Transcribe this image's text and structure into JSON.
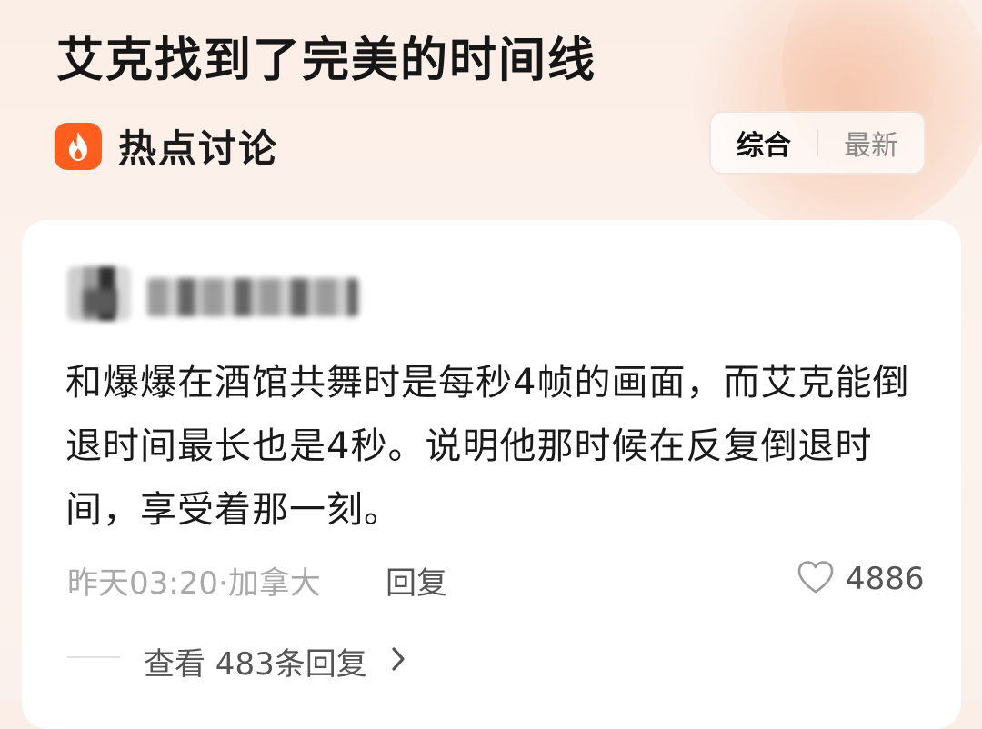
{
  "page": {
    "title": "艾克找到了完美的时间线"
  },
  "section": {
    "label": "热点讨论",
    "icon": "fire-icon",
    "accent_color": "#ff5e1f"
  },
  "sort": {
    "options": [
      "综合",
      "最新"
    ],
    "selected": "综合"
  },
  "comment": {
    "text": "和爆爆在酒馆共舞时是每秒4帧的画面，而艾克能倒退时间最长也是4秒。说明他那时候在反复倒退时间，享受着那一刻。",
    "meta": "昨天03:20·加拿大",
    "reply_label": "回复",
    "like_icon": "heart-outline-icon",
    "like_count": "4886",
    "view_replies_label": "查看 483条回复",
    "view_replies_icon": "chevron-right-icon"
  }
}
